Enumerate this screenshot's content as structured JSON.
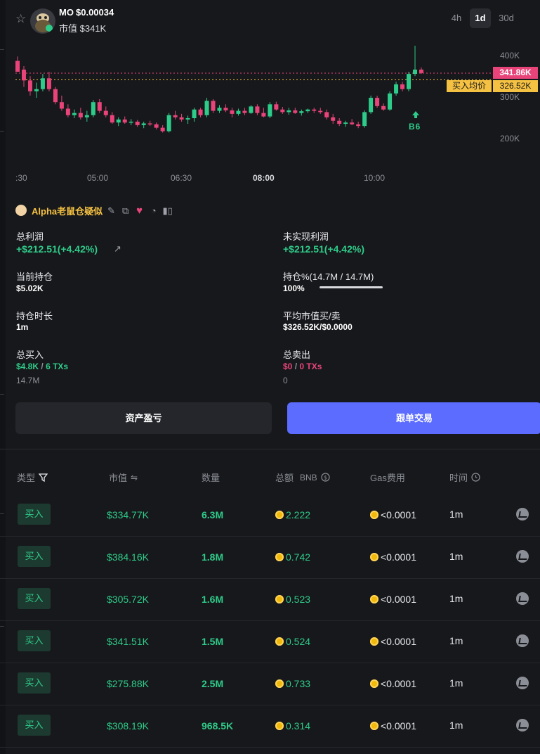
{
  "header": {
    "token": "MO",
    "price": "$0.00034",
    "market_cap": "市值 $341K",
    "timeframes": [
      "4h",
      "1d",
      "30d"
    ],
    "active_timeframe": "1d"
  },
  "chart": {
    "x_ticks": [
      ":30",
      "05:00",
      "06:30",
      "08:00",
      "10:00"
    ],
    "y_ticks": [
      "400K",
      "300K",
      "200K"
    ],
    "price_tag": "341.86K",
    "avg_label": "买入均价",
    "avg_tag": "326.52K",
    "marker": "B6",
    "colors": {
      "up": "#2ecc8a",
      "down": "#e8447a"
    }
  },
  "chart_data": {
    "type": "candlestick",
    "x_labels": [
      ":30",
      "05:00",
      "06:30",
      "08:00",
      "10:00"
    ],
    "y_ticks": [
      "400K",
      "300K",
      "200K"
    ],
    "current_price": "341.86K",
    "avg_buy_price": "326.52K",
    "candles": [
      [
        370,
        380,
        350,
        345
      ],
      [
        350,
        358,
        310,
        325
      ],
      [
        325,
        335,
        290,
        300
      ],
      [
        300,
        320,
        285,
        305
      ],
      [
        305,
        340,
        300,
        330
      ],
      [
        330,
        345,
        300,
        305
      ],
      [
        305,
        310,
        270,
        275
      ],
      [
        275,
        290,
        255,
        260
      ],
      [
        260,
        270,
        240,
        245
      ],
      [
        245,
        258,
        238,
        250
      ],
      [
        250,
        262,
        235,
        240
      ],
      [
        240,
        255,
        230,
        245
      ],
      [
        245,
        280,
        240,
        275
      ],
      [
        275,
        282,
        250,
        255
      ],
      [
        255,
        265,
        240,
        245
      ],
      [
        245,
        252,
        225,
        228
      ],
      [
        228,
        240,
        220,
        235
      ],
      [
        235,
        242,
        225,
        228
      ],
      [
        228,
        236,
        222,
        230
      ],
      [
        230,
        234,
        218,
        222
      ],
      [
        222,
        230,
        215,
        226
      ],
      [
        226,
        232,
        220,
        224
      ],
      [
        224,
        228,
        212,
        216
      ],
      [
        216,
        222,
        205,
        208
      ],
      [
        208,
        250,
        205,
        245
      ],
      [
        245,
        255,
        235,
        240
      ],
      [
        240,
        248,
        230,
        235
      ],
      [
        235,
        244,
        225,
        238
      ],
      [
        238,
        262,
        230,
        258
      ],
      [
        258,
        262,
        240,
        245
      ],
      [
        245,
        285,
        240,
        278
      ],
      [
        278,
        282,
        250,
        255
      ],
      [
        255,
        268,
        250,
        262
      ],
      [
        262,
        270,
        252,
        256
      ],
      [
        256,
        262,
        240,
        248
      ],
      [
        248,
        260,
        244,
        255
      ],
      [
        255,
        262,
        245,
        250
      ],
      [
        250,
        268,
        248,
        265
      ],
      [
        265,
        270,
        245,
        250
      ],
      [
        250,
        262,
        240,
        242
      ],
      [
        242,
        275,
        238,
        270
      ],
      [
        270,
        276,
        255,
        258
      ],
      [
        258,
        264,
        248,
        252
      ],
      [
        252,
        262,
        246,
        256
      ],
      [
        256,
        262,
        248,
        250
      ],
      [
        250,
        258,
        244,
        254
      ],
      [
        254,
        260,
        250,
        258
      ],
      [
        258,
        262,
        250,
        255
      ],
      [
        255,
        262,
        248,
        252
      ],
      [
        252,
        258,
        235,
        240
      ],
      [
        240,
        248,
        225,
        232
      ],
      [
        232,
        238,
        220,
        225
      ],
      [
        225,
        232,
        218,
        228
      ],
      [
        228,
        236,
        222,
        224
      ],
      [
        224,
        230,
        215,
        220
      ],
      [
        220,
        256,
        216,
        252
      ],
      [
        252,
        290,
        248,
        285
      ],
      [
        285,
        290,
        262,
        266
      ],
      [
        266,
        272,
        255,
        258
      ],
      [
        258,
        300,
        255,
        295
      ],
      [
        295,
        322,
        290,
        316
      ],
      [
        316,
        322,
        300,
        305
      ],
      [
        305,
        345,
        300,
        340
      ],
      [
        340,
        405,
        335,
        350
      ],
      [
        350,
        355,
        340,
        342
      ]
    ]
  },
  "wallet": {
    "name": "Alpha老鼠仓疑似"
  },
  "stats": {
    "total_profit_label": "总利润",
    "total_profit_value": "+$212.51(+4.42%)",
    "unrealized_label": "未实现利润",
    "unrealized_value": "+$212.51(+4.42%)",
    "holding_label": "当前持仓",
    "holding_value": "$5.02K",
    "holding_pct_label": "持仓%(14.7M / 14.7M)",
    "holding_pct_value": "100%",
    "holding_pct": 1.0,
    "duration_label": "持仓时长",
    "duration_value": "1m",
    "avg_mcap_label": "平均市值买/卖",
    "avg_mcap_value": "$326.52K/$0.0000",
    "total_buy_label": "总买入",
    "total_buy_amount": "$4.8K",
    "total_buy_sep": "/",
    "total_buy_txs": "6 TXs",
    "total_buy_qty": "14.7M",
    "total_sell_label": "总卖出",
    "total_sell_amount": "$0",
    "total_sell_sep": "/",
    "total_sell_txs": "0 TXs",
    "total_sell_qty": "0"
  },
  "buttons": {
    "pnl": "资产盈亏",
    "copy_trade": "跟单交易"
  },
  "table": {
    "headers": {
      "type": "类型",
      "mcap": "市值",
      "qty": "数量",
      "amount": "总额",
      "amount_unit": "BNB",
      "gas": "Gas费用",
      "time": "时间"
    },
    "rows": [
      {
        "type": "买入",
        "mcap": "$334.77K",
        "qty": "6.3M",
        "amount": "2.222",
        "gas": "<0.0001",
        "time": "1m"
      },
      {
        "type": "买入",
        "mcap": "$384.16K",
        "qty": "1.8M",
        "amount": "0.742",
        "gas": "<0.0001",
        "time": "1m"
      },
      {
        "type": "买入",
        "mcap": "$305.72K",
        "qty": "1.6M",
        "amount": "0.523",
        "gas": "<0.0001",
        "time": "1m"
      },
      {
        "type": "买入",
        "mcap": "$341.51K",
        "qty": "1.5M",
        "amount": "0.524",
        "gas": "<0.0001",
        "time": "1m"
      },
      {
        "type": "买入",
        "mcap": "$275.88K",
        "qty": "2.5M",
        "amount": "0.733",
        "gas": "<0.0001",
        "time": "1m"
      },
      {
        "type": "买入",
        "mcap": "$308.19K",
        "qty": "968.5K",
        "amount": "0.314",
        "gas": "<0.0001",
        "time": "1m"
      }
    ]
  }
}
